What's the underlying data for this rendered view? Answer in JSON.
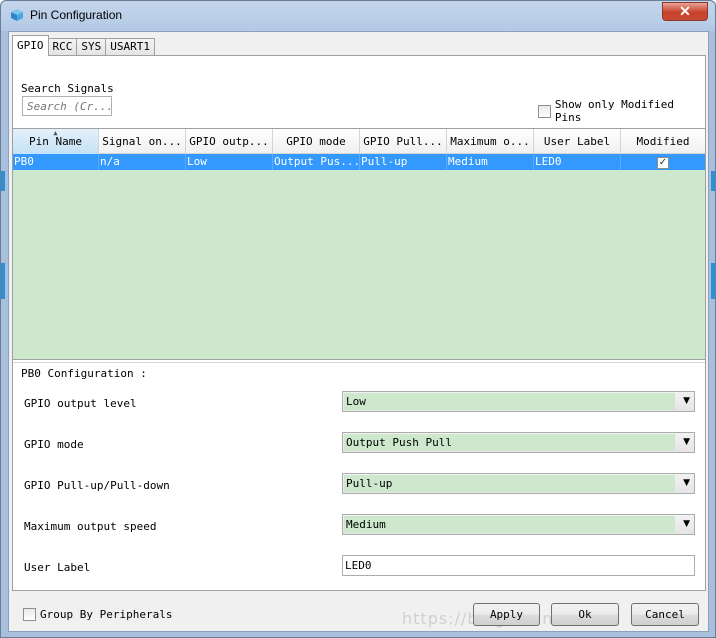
{
  "window": {
    "title": "Pin Configuration",
    "close_label": "✕"
  },
  "tabs": [
    {
      "label": "GPIO",
      "active": true
    },
    {
      "label": "RCC",
      "active": false
    },
    {
      "label": "SYS",
      "active": false
    },
    {
      "label": "USART1",
      "active": false
    }
  ],
  "search": {
    "label": "Search Signals",
    "placeholder": "Search (Cr..."
  },
  "filter": {
    "show_modified_label": "Show only Modified Pins"
  },
  "table": {
    "columns": [
      "Pin Name",
      "Signal on...",
      "GPIO outp...",
      "GPIO mode",
      "GPIO Pull...",
      "Maximum o...",
      "User Label",
      "Modified"
    ],
    "rows": [
      {
        "pin": "PB0",
        "signal": "n/a",
        "output": "Low",
        "mode": "Output Pus...",
        "pull": "Pull-up",
        "speed": "Medium",
        "label": "LED0",
        "modified": "✓"
      }
    ]
  },
  "config": {
    "title": "PB0 Configuration :",
    "fields": [
      {
        "label": "GPIO output level",
        "value": "Low"
      },
      {
        "label": "GPIO mode",
        "value": "Output Push Pull"
      },
      {
        "label": "GPIO Pull-up/Pull-down",
        "value": "Pull-up"
      },
      {
        "label": "Maximum output speed",
        "value": "Medium"
      },
      {
        "label": "User Label",
        "value": "LED0"
      }
    ]
  },
  "footer": {
    "group_label": "Group By Peripherals",
    "apply": "Apply",
    "ok": "Ok",
    "cancel": "Cancel",
    "watermark": "https://blog.csdn.net/..."
  }
}
